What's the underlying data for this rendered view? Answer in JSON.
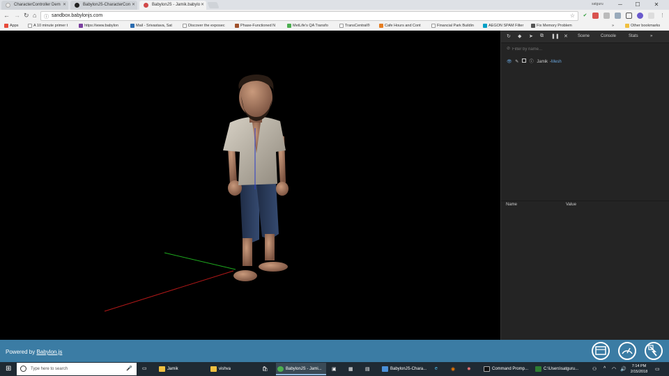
{
  "browser": {
    "tabs": [
      {
        "label": "CharacterController Dem",
        "color": "#e8e8e8"
      },
      {
        "label": "BabylonJS-CharacterCon",
        "color": "#222222"
      },
      {
        "label": "BabylonJS - Jamik.babylo",
        "color": "#d14a4a"
      }
    ],
    "user": "satguru",
    "url": "sandbox.babylonjs.com",
    "bookmarks": [
      {
        "label": "Apps",
        "color": "#e74c3c"
      },
      {
        "label": "A 10 minute primer t",
        "color": "#ffffff"
      },
      {
        "label": "https://www.babylon",
        "color": "#7b3fa0"
      },
      {
        "label": "Mail - Srivastava, Sat",
        "color": "#2b6cb0"
      },
      {
        "label": "Discover the exposec",
        "color": "#ffffff"
      },
      {
        "label": "Phase-Functioned N",
        "color": "#a0522d"
      },
      {
        "label": "MetLife's QA Transfo",
        "color": "#4caf50"
      },
      {
        "label": "TransCentral®",
        "color": "#ffffff"
      },
      {
        "label": "Cafe Hours and Cont",
        "color": "#e67e22"
      },
      {
        "label": "Financial Park Buildin",
        "color": "#ffffff"
      },
      {
        "label": "AEGON SPAM Filter",
        "color": "#00a0c6"
      },
      {
        "label": "Fix Memory Problem",
        "color": "#555555"
      },
      {
        "label": "Other bookmarks",
        "color": "#f0c040"
      }
    ]
  },
  "inspector": {
    "tabs": [
      "Scene",
      "Console",
      "Stats",
      "»"
    ],
    "filter_placeholder": "Filter by name...",
    "tree_item": {
      "name": "Jamik",
      "separator": " - ",
      "type": "Mesh"
    },
    "props_columns": [
      "Name",
      "Value"
    ]
  },
  "footer": {
    "powered_prefix": "Powered by ",
    "powered_link": "Babylon.js"
  },
  "taskbar": {
    "search_placeholder": "Type here to search",
    "apps": [
      {
        "label": "Jamik",
        "color": "#f0c040",
        "active": false
      },
      {
        "label": "vishva",
        "color": "#f0c040",
        "active": false
      },
      {
        "label": "BabylonJS - Jami...",
        "color": "#4caf50",
        "active": true
      },
      {
        "label": "BabylonJS-Chara...",
        "color": "#4a90d9",
        "active": false
      },
      {
        "label": "Command Promp...",
        "color": "#111111",
        "active": false
      },
      {
        "label": "C:\\Users\\satguru...",
        "color": "#2e7d32",
        "active": false
      }
    ],
    "time": "7:14 PM",
    "date": "2/15/2018"
  },
  "colors": {
    "footer_bg": "#3b7ca4",
    "inspector_bg": "#242424",
    "mesh_type": "#6aa8e0"
  }
}
